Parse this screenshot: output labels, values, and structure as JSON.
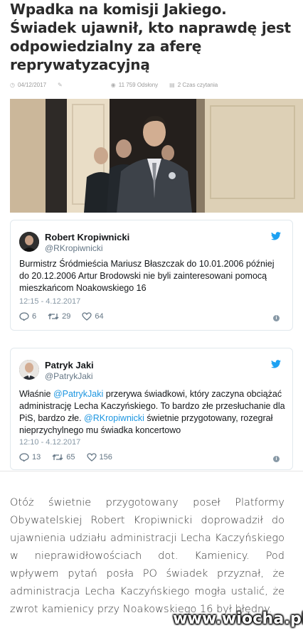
{
  "article": {
    "title": "Wpadka na komisji Jakiego. Świadek ujawnił, kto naprawdę jest odpowiedzialny za aferę reprywatyzacyjną",
    "date": "04/12/2017",
    "views": "11 759 Odsłony",
    "read_time": "2 Czas czytania",
    "body": "Otóż świetnie przygotowany poseł Platformy Obywatelskiej Robert Kropiwnicki doprowadził do ujawnienia udziału administracji Lecha Kaczyńskiego w nieprawidłowościach dot. Kamienicy. Pod wpływem pytań posła PO świadek przyznał, że administracja Lecha Kaczyńskiego mogła ustalić, że zwrot kamienicy przy Noakowskiego 16 był błędny."
  },
  "tweets": [
    {
      "name": "Robert Kropiwnicki",
      "handle": "@RKropiwnicki",
      "text_parts": [
        {
          "t": "Burmistrz Śródmieścia Mariusz Błaszczak do 10.01.2006 później do 20.12.2006 Artur Brodowski nie byli zainteresowani pomocą mieszkańcom Noakowskiego 16",
          "mention": false
        }
      ],
      "time": "12:15 - 4.12.2017",
      "replies": "6",
      "retweets": "29",
      "likes": "64"
    },
    {
      "name": "Patryk Jaki",
      "handle": "@PatrykJaki",
      "text_parts": [
        {
          "t": "Właśnie ",
          "mention": false
        },
        {
          "t": "@PatrykJaki",
          "mention": true
        },
        {
          "t": " przerywa świadkowi, który zaczyna obciążać administrację Lecha Kaczyńskiego. To bardzo złe przesłuchanie dla PiS, bardzo złe. ",
          "mention": false
        },
        {
          "t": "@RKropiwnicki",
          "mention": true
        },
        {
          "t": " świetnie przygotowany, rozegrał nieprzychylnego mu świadka koncertowo",
          "mention": false
        }
      ],
      "time": "12:10 - 4.12.2017",
      "replies": "13",
      "retweets": "65",
      "likes": "156"
    }
  ],
  "watermark": "www.wiocha.pl",
  "icons": {
    "date": "clock-icon",
    "author": "pen-icon",
    "views": "eye-icon",
    "read_time": "document-icon",
    "twitter": "twitter-bird-icon",
    "reply": "reply-icon",
    "retweet": "retweet-icon",
    "like": "heart-icon",
    "info": "info-icon"
  },
  "colors": {
    "twitter_blue": "#1da1f2",
    "mention": "#1b95e0",
    "retweet_green": "#17bf63",
    "title": "#2b2b2b"
  }
}
